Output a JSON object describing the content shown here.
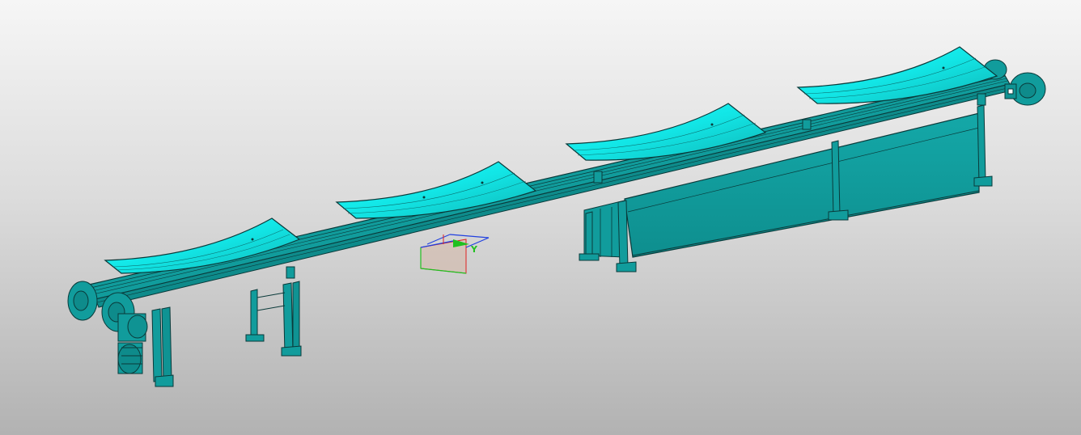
{
  "viewport": {
    "background_top": "#f6f6f6",
    "background_bottom": "#b2b2b2"
  },
  "model": {
    "description_icon": "conveyor-assembly-3d",
    "body_color": "#119c9c",
    "edge_color": "#0a3a3a",
    "highlight_color": "#19f0f0",
    "trays_count_visible": 4
  },
  "triad": {
    "x_color": "#e02020",
    "y_color": "#20c020",
    "z_color": "#2040e0",
    "y_label": "Y"
  }
}
